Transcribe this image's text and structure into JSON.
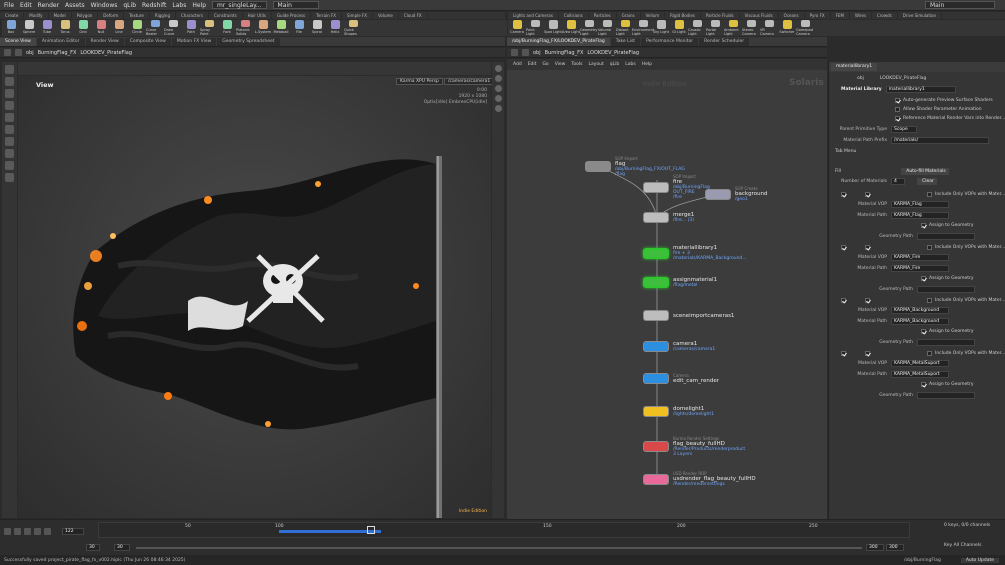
{
  "menubar": {
    "items": [
      "File",
      "Edit",
      "Render",
      "Assets",
      "Windows",
      "qLib",
      "Redshift",
      "Labs",
      "Help"
    ],
    "scene_file": "mr_singleLay...",
    "desktop": "Main",
    "right_desktop": "Main"
  },
  "shelf_left": {
    "tabs": [
      "Create",
      "Modify",
      "Model",
      "Polygon",
      "Deform",
      "Texture",
      "Rigging",
      "Characters",
      "Constraints",
      "Hair Utils",
      "Guide Process",
      "Terrain FX",
      "Simple FX",
      "Volume",
      "Cloud FX"
    ],
    "tools": [
      "Box",
      "Sphere",
      "Tube",
      "Torus",
      "Grid",
      "Null",
      "Line",
      "Circle",
      "Curve Bezier",
      "Draw Curve",
      "Path",
      "Spray Paint",
      "Font",
      "Platonic Solids",
      "L-System",
      "Metaball",
      "File",
      "Spiral",
      "Helix",
      "Quick Shapes"
    ]
  },
  "shelf_right": {
    "tabs": [
      "Lights and Cameras",
      "Collisions",
      "Particles",
      "Grains",
      "Vellum",
      "Rigid Bodies",
      "Particle Fluids",
      "Viscous Fluids",
      "Oceans",
      "Pyro FX",
      "FEM",
      "Wires",
      "Crowds",
      "Drive Simulation"
    ],
    "tools": [
      "Camera",
      "Point Light",
      "Spot Light",
      "Area Light",
      "Geometry Light",
      "Volume Light",
      "Distant Light",
      "Environment Light",
      "Sky Light",
      "GI Light",
      "Caustic Light",
      "Portal Light",
      "Ambient Light",
      "Stereo Camera",
      "VR Camera",
      "Switcher",
      "Gamepad Camera"
    ]
  },
  "left_pane": {
    "tabs": [
      "Scene View",
      "Animation Editor",
      "Render View",
      "Composite View",
      "Motion FX View",
      "Geometry Spreadsheet"
    ],
    "path": [
      "obj",
      "BurningFlag_FX",
      "LOOKDEV_PirateFlag"
    ],
    "view_label": "View",
    "renderer": "Karma XPU Persp",
    "camera": "/cameras/camera1",
    "info_lines": [
      "0:00",
      "1920 x 1080",
      "Optix[idle] EmbreeCPU[idle]"
    ],
    "edition": "Indie Edition"
  },
  "middle_pane": {
    "tabs": [
      "/obj/BurningFlag_FX/LOOKDEV_PirateFlag",
      "Take List",
      "Performance Monitor",
      "Render Scheduler"
    ],
    "path": [
      "obj",
      "BurningFlag_FX",
      "LOOKDEV_PirateFlag"
    ],
    "menu": [
      "Add",
      "Edit",
      "Go",
      "View",
      "Tools",
      "Layout",
      "qLib",
      "Labs",
      "Help"
    ],
    "watermark_edition": "Indie Edition",
    "watermark_context": "Solaris",
    "nodes": [
      {
        "name": "flag",
        "type": "SOP Import",
        "sub": "/obj/BurningFlag_FX/OUT_FLAG\n/flag"
      },
      {
        "name": "fire",
        "type": "SOP Import",
        "sub": "/obj/BurningFlag\nOUT_FIRE\n/fire"
      },
      {
        "name": "background",
        "type": "SOP Create",
        "sub": "/geo1"
      },
      {
        "name": "merge1",
        "type": "",
        "sub": "/fire...  (3)"
      },
      {
        "name": "materiallibrary1",
        "type": "",
        "sub": "fire + 3\n/materials/KARMA_Background..."
      },
      {
        "name": "assignmaterial1",
        "type": "",
        "sub": "/flag/metal"
      },
      {
        "name": "sceneimportcameras1",
        "type": "",
        "sub": ""
      },
      {
        "name": "camera1",
        "type": "",
        "sub": "/cameras/camera1"
      },
      {
        "name": "edit_cam_render",
        "type": "Camera",
        "sub": ""
      },
      {
        "name": "domelight1",
        "type": "",
        "sub": "/lights/domelight1"
      },
      {
        "name": "flag_beauty_fullHD",
        "type": "Karma Render Settings",
        "sub": "/Render/Products/renderproduct\n3 Layers"
      },
      {
        "name": "usdrender_flag_beauty_fullHD",
        "type": "USD Render ROP",
        "sub": "/Render/rendersettings"
      }
    ]
  },
  "params": {
    "tabs": [
      "materiallibrary1"
    ],
    "path": [
      "obj",
      "LOOKDEV_PirateFlag"
    ],
    "node_type": "Material Library",
    "node_name": "materiallibrary1",
    "toggles": [
      "Auto-generate Preview Surface Shaders",
      "Allow Shader Parameter Animation",
      "Reference Material Render Vars into Render..."
    ],
    "parent_prim_label": "Parent Primitive Type",
    "parent_prim_value": "Scope",
    "material_path_prefix_label": "Material Path Prefix",
    "material_path_prefix_value": "/materials/",
    "tab_menu_label": "Tab Menu",
    "fill_label": "Fill",
    "auto_fill_label": "Auto-fill Materials",
    "num_materials_label": "Number of Materials",
    "num_materials_value": "4",
    "clear_label": "Clear",
    "include_label": "Include Only VOPs with Mater...",
    "material_vop_label": "Material VOP",
    "material_path_label": "Material Path",
    "assign_label": "Assign to Geometry",
    "geometry_path_label": "Geometry Path",
    "materials": [
      {
        "vop": "KARMA_Flag",
        "path": "KARMA_Flag"
      },
      {
        "vop": "KARMA_Fire",
        "path": "KARMA_Fire"
      },
      {
        "vop": "KARMA_Background",
        "path": "KARMA_Background"
      },
      {
        "vop": "KARMA_MetalSuport",
        "path": "KARMA_MetalSuport"
      }
    ]
  },
  "timeline": {
    "current_frame": "122",
    "ticks": [
      "50",
      "100",
      "150",
      "200",
      "250"
    ],
    "start_a": "30",
    "start_b": "30",
    "end_a": "300",
    "end_b": "300",
    "keys_label": "0 keys, 0/0 channels",
    "key_all_label": "Key All Channels",
    "auto_update": "Auto Update",
    "status_path": "/obj/BurningFlag"
  },
  "status": {
    "message": "Successfully saved project_pirate_flag_fx_v002.hiplc (Thu Jun 26 08:46:34 2025)"
  },
  "colors": {
    "accent_green": "#2ec52e",
    "link_blue": "#6fa7ff"
  }
}
